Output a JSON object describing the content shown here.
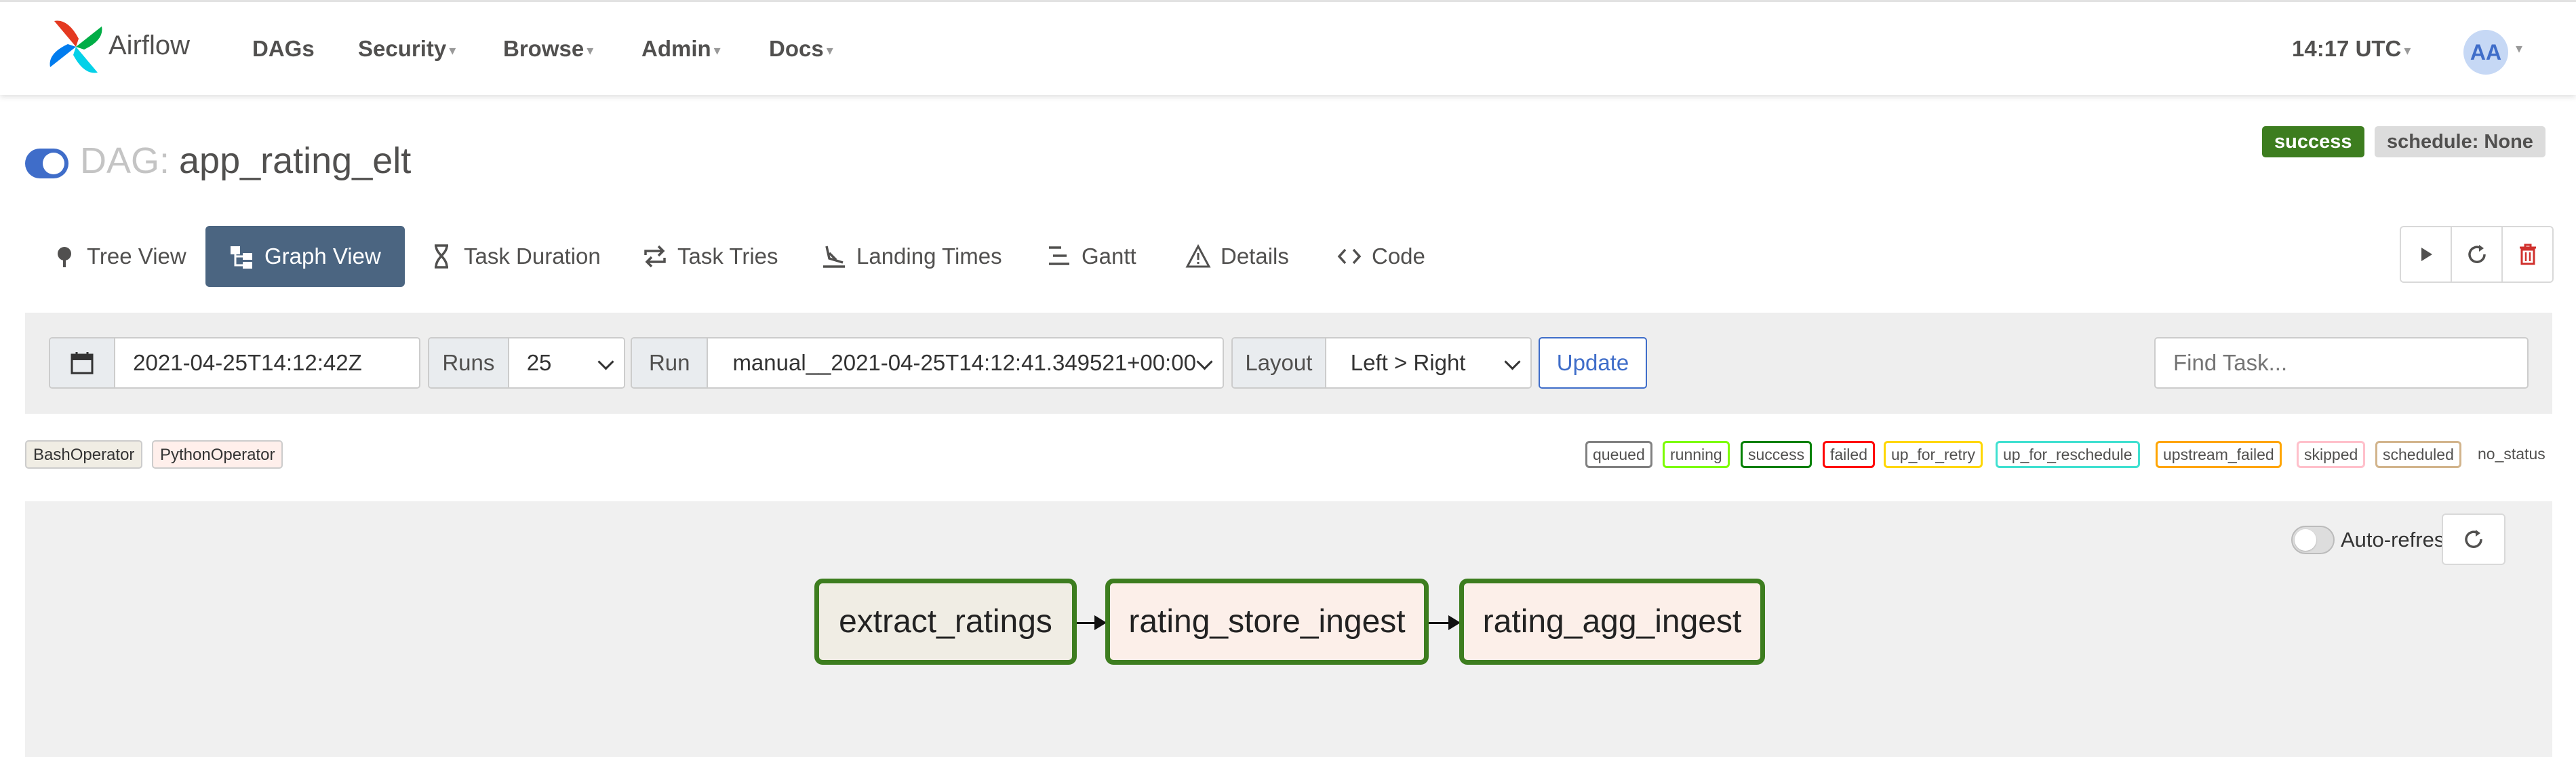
{
  "navbar": {
    "brand": "Airflow",
    "items": [
      {
        "label": "DAGs",
        "has_dropdown": false
      },
      {
        "label": "Security",
        "has_dropdown": true
      },
      {
        "label": "Browse",
        "has_dropdown": true
      },
      {
        "label": "Admin",
        "has_dropdown": true
      },
      {
        "label": "Docs",
        "has_dropdown": true
      }
    ],
    "clock": "14:17 UTC",
    "user_initials": "AA"
  },
  "dag": {
    "prefix": "DAG:",
    "name": "app_rating_elt",
    "paused": false,
    "status_badge": "success",
    "schedule_badge": "schedule: None"
  },
  "tabs": [
    {
      "label": "Tree View",
      "icon": "tree-icon",
      "active": false
    },
    {
      "label": "Graph View",
      "icon": "graph-icon",
      "active": true
    },
    {
      "label": "Task Duration",
      "icon": "hourglass-icon",
      "active": false
    },
    {
      "label": "Task Tries",
      "icon": "repeat-icon",
      "active": false
    },
    {
      "label": "Landing Times",
      "icon": "landing-icon",
      "active": false
    },
    {
      "label": "Gantt",
      "icon": "gantt-icon",
      "active": false
    },
    {
      "label": "Details",
      "icon": "warning-triangle-icon",
      "active": false
    },
    {
      "label": "Code",
      "icon": "code-icon",
      "active": false
    }
  ],
  "actions": [
    {
      "name": "trigger-dag",
      "icon": "play-icon"
    },
    {
      "name": "refresh",
      "icon": "refresh-icon"
    },
    {
      "name": "delete-dag",
      "icon": "trash-icon"
    }
  ],
  "filters": {
    "base_date": "2021-04-25T14:12:42Z",
    "runs_label": "Runs",
    "runs_value": "25",
    "run_label": "Run",
    "run_value": "manual__2021-04-25T14:12:41.349521+00:00",
    "layout_label": "Layout",
    "layout_value": "Left > Right",
    "update_label": "Update",
    "find_task_placeholder": "Find Task..."
  },
  "operator_legend": [
    {
      "label": "BashOperator",
      "color": "#f0ede4"
    },
    {
      "label": "PythonOperator",
      "color": "#ffefeb"
    }
  ],
  "status_legend": [
    {
      "label": "queued",
      "color": "#808080"
    },
    {
      "label": "running",
      "color": "#7cfc00"
    },
    {
      "label": "success",
      "color": "#008000"
    },
    {
      "label": "failed",
      "color": "#ff0000"
    },
    {
      "label": "up_for_retry",
      "color": "#ffd700"
    },
    {
      "label": "up_for_reschedule",
      "color": "#40e0d0"
    },
    {
      "label": "upstream_failed",
      "color": "#ffa500"
    },
    {
      "label": "skipped",
      "color": "#ffc0cb"
    },
    {
      "label": "scheduled",
      "color": "#d2b48c"
    }
  ],
  "no_status_label": "no_status",
  "graph": {
    "auto_refresh_label": "Auto-refresh",
    "auto_refresh_on": false,
    "tasks": [
      {
        "id": "extract_ratings",
        "operator": "BashOperator",
        "state": "success"
      },
      {
        "id": "rating_store_ingest",
        "operator": "PythonOperator",
        "state": "success"
      },
      {
        "id": "rating_agg_ingest",
        "operator": "PythonOperator",
        "state": "success"
      }
    ],
    "edges": [
      {
        "from": "extract_ratings",
        "to": "rating_store_ingest"
      },
      {
        "from": "rating_store_ingest",
        "to": "rating_agg_ingest"
      }
    ],
    "success_color": "#3d7d1f"
  }
}
